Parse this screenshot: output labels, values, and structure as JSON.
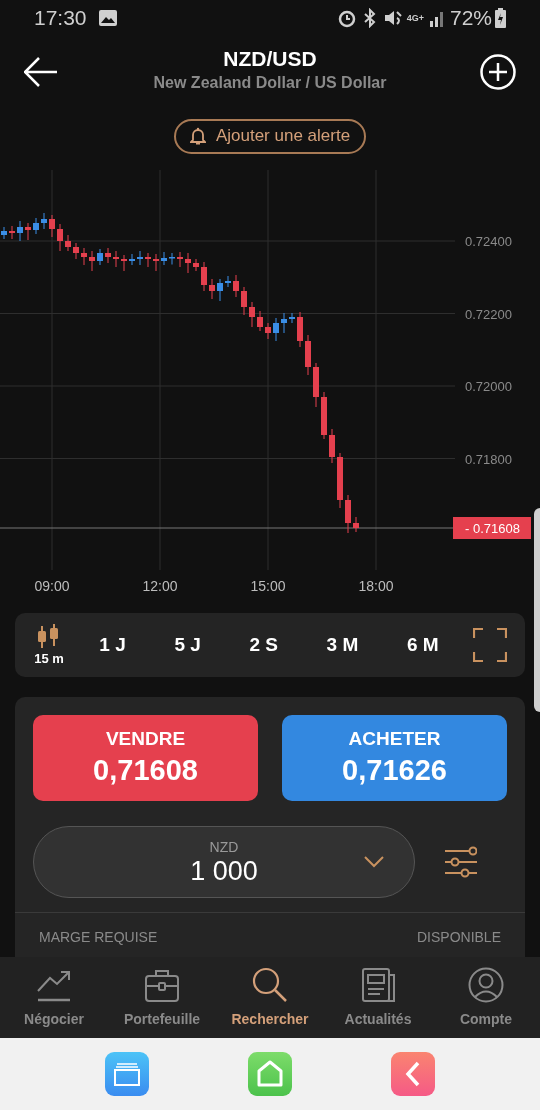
{
  "status_bar": {
    "time": "17:30",
    "network": "4G+",
    "battery": "72%"
  },
  "header": {
    "title": "NZD/USD",
    "subtitle": "New Zealand Dollar / US Dollar",
    "alert_button": "Ajouter une alerte"
  },
  "chart": {
    "yticks": [
      "0.72400",
      "0.72200",
      "0.72000",
      "0.71800"
    ],
    "xticks": [
      "09:00",
      "12:00",
      "15:00",
      "18:00"
    ],
    "last_price": "- 0.71608"
  },
  "timeframes": {
    "interval": "15 m",
    "ranges": [
      "1 J",
      "5 J",
      "2 S",
      "3 M",
      "6 M"
    ]
  },
  "trade": {
    "sell": {
      "label": "VENDRE",
      "price": "0,71608"
    },
    "buy": {
      "label": "ACHETER",
      "price": "0,71626"
    },
    "amount": {
      "currency": "NZD",
      "value": "1 000"
    },
    "footer_left": "MARGE REQUISE",
    "footer_right": "DISPONIBLE"
  },
  "nav": [
    {
      "label": "Négocier",
      "kind": "trend",
      "selected": false
    },
    {
      "label": "Portefeuille",
      "kind": "briefcase",
      "selected": false
    },
    {
      "label": "Rechercher",
      "kind": "search",
      "selected": true
    },
    {
      "label": "Actualités",
      "kind": "news",
      "selected": false
    },
    {
      "label": "Compte",
      "kind": "account",
      "selected": false
    }
  ]
}
